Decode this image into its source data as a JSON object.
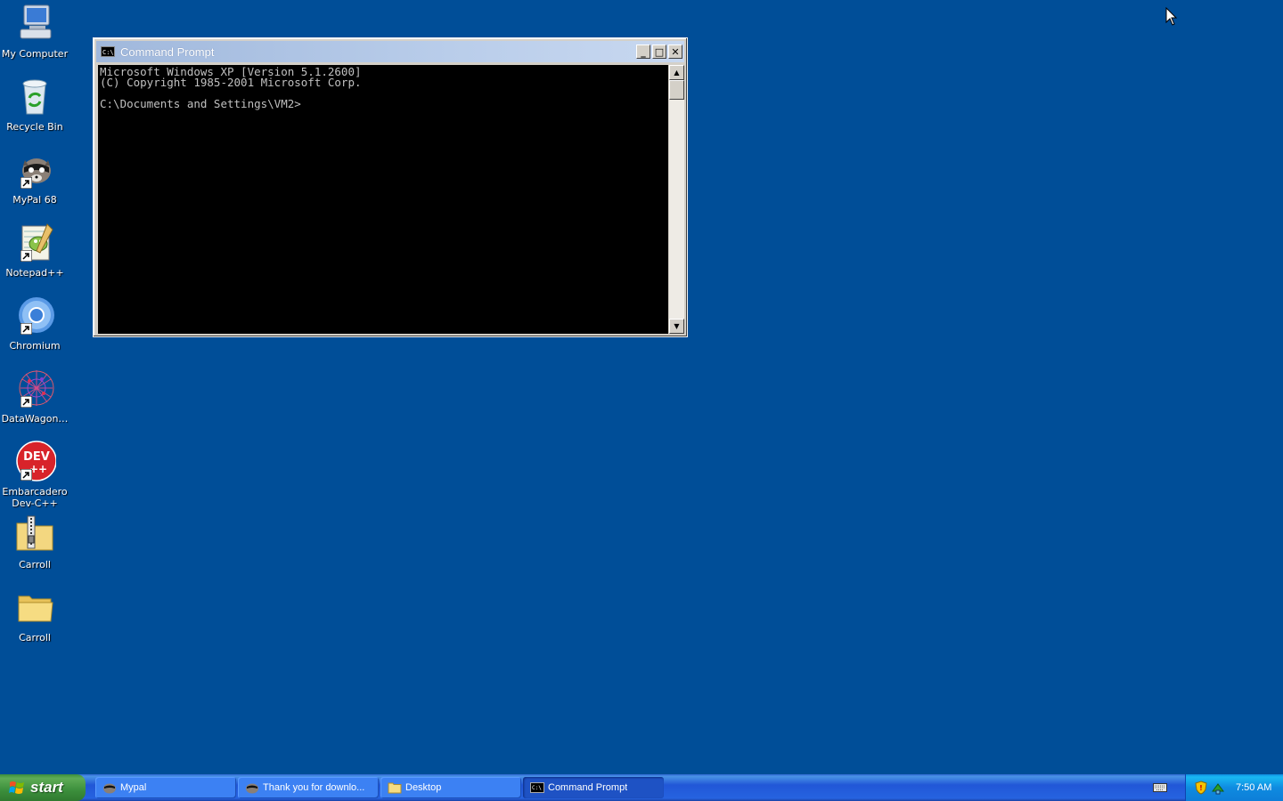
{
  "desktop": {
    "background_color": "#004e98",
    "icons": [
      {
        "label": "My Computer",
        "icon": "my-computer-icon"
      },
      {
        "label": "Recycle Bin",
        "icon": "recycle-bin-icon"
      },
      {
        "label": "MyPal 68",
        "icon": "mypal-icon"
      },
      {
        "label": "Notepad++",
        "icon": "notepad-plus-plus-icon"
      },
      {
        "label": "Chromium",
        "icon": "chromium-icon"
      },
      {
        "label": "DataWagon…",
        "icon": "datawagon-icon"
      },
      {
        "label": "Embarcadero Dev-C++",
        "icon": "dev-cpp-icon"
      },
      {
        "label": "Carroll",
        "icon": "zip-folder-icon"
      },
      {
        "label": "Carroll",
        "icon": "folder-icon"
      }
    ]
  },
  "cmd_window": {
    "title": "Command Prompt",
    "minimize_label": "_",
    "maximize_label": "□",
    "close_label": "✕",
    "console_text": "Microsoft Windows XP [Version 5.1.2600]\n(C) Copyright 1985-2001 Microsoft Corp.\n\nC:\\Documents and Settings\\VM2>"
  },
  "taskbar": {
    "start_label": "start",
    "tasks": [
      {
        "label": "Mypal",
        "icon": "mypal-icon"
      },
      {
        "label": "Thank you for downlo...",
        "icon": "mypal-icon"
      },
      {
        "label": "Desktop",
        "icon": "folder-icon"
      },
      {
        "label": "Command Prompt",
        "icon": "cmd-icon"
      }
    ],
    "clock": "7:50 AM"
  }
}
